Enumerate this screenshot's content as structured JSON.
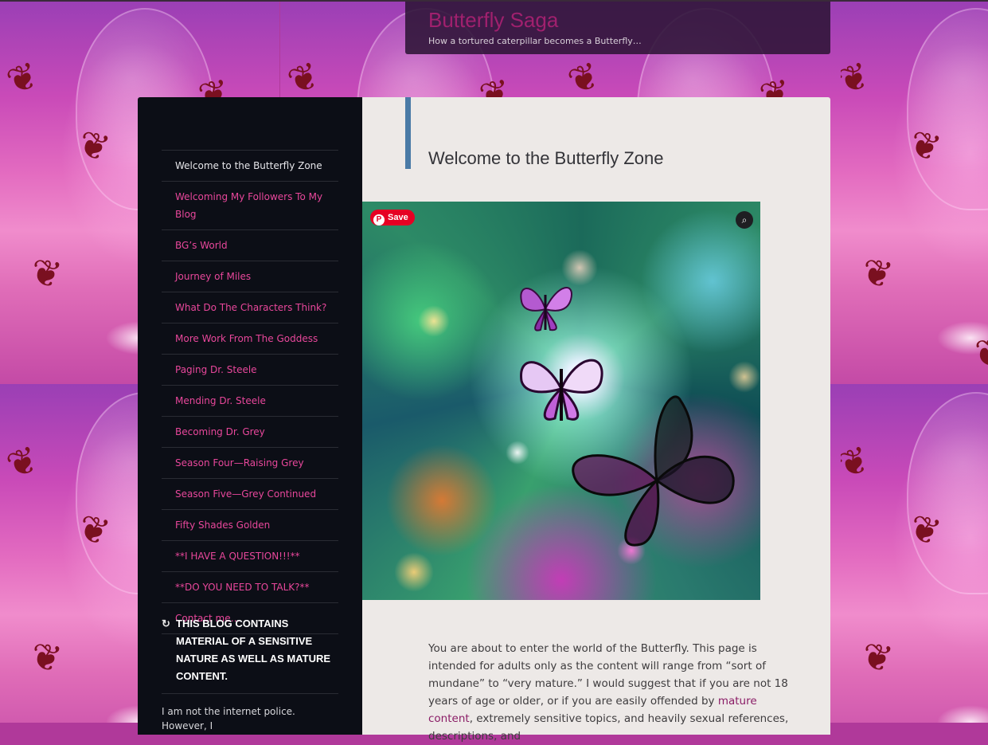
{
  "header": {
    "site_title": "Butterfly Saga",
    "tagline": "How a tortured caterpillar becomes a Butterfly…"
  },
  "sidebar": {
    "nav_items": [
      {
        "label": "Welcome to the Butterfly Zone",
        "current": true
      },
      {
        "label": "Welcoming My Followers To My Blog"
      },
      {
        "label": "BG’s World"
      },
      {
        "label": "Journey of Miles"
      },
      {
        "label": "What Do The Characters Think?"
      },
      {
        "label": "More Work From The Goddess"
      },
      {
        "label": "Paging Dr. Steele"
      },
      {
        "label": "Mending Dr. Steele"
      },
      {
        "label": "Becoming Dr. Grey"
      },
      {
        "label": "Season Four—Raising Grey"
      },
      {
        "label": "Season Five—Grey Continued"
      },
      {
        "label": "Fifty Shades Golden"
      },
      {
        "label": "**I HAVE A QUESTION!!!**"
      },
      {
        "label": "**DO YOU NEED TO TALK?**"
      },
      {
        "label": "Contact me…"
      }
    ],
    "widget": {
      "icon": "spiral-icon",
      "title": "THIS BLOG CONTAINS MATERIAL OF A SENSITIVE NATURE AS WELL AS MATURE CONTENT.",
      "text": "I am not the internet police. However, I"
    }
  },
  "content": {
    "entry_title": "Welcome to the Butterfly Zone",
    "pinterest_save_label": "Save",
    "body_before_link": "You are about to enter the world of the Butterfly. This page is intended for adults only as the content will range from “sort of mundane” to “very mature.” I would suggest that if you are not 18 years of age or older, or if you are easily offended by ",
    "body_link": "mature content",
    "body_after_link": ", extremely sensitive topics, and heavily sexual references, descriptions, and"
  },
  "colors": {
    "accent_pink": "#e8479b",
    "title_bar_blue": "#4a7aa6",
    "site_title": "#a0206e",
    "sidebar_bg": "#0c0e16",
    "content_bg": "#ede9e7"
  }
}
